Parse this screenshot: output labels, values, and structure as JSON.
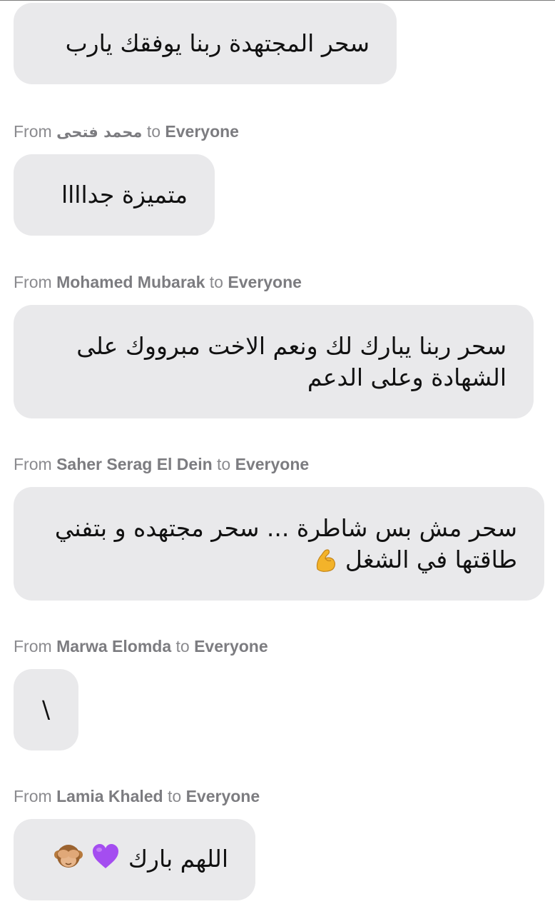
{
  "messages": [
    {
      "text": "سحر المجتهدة ربنا يوفقك يارب"
    },
    {
      "from_label": "From",
      "sender": "محمد فتحى",
      "to_label": "to",
      "recipient": "Everyone",
      "text": "متميزة جداااا"
    },
    {
      "from_label": "From",
      "sender": "Mohamed Mubarak",
      "to_label": "to",
      "recipient": "Everyone",
      "text": "سحر ربنا يبارك لك ونعم الاخت مبرووك على الشهادة وعلى الدعم"
    },
    {
      "from_label": "From",
      "sender": "Saher Serag El Dein",
      "to_label": "to",
      "recipient": "Everyone",
      "text": "سحر مش بس شاطرة ... سحر مجتهده و بتفني طاقتها في الشغل",
      "emoji": "flexed-biceps"
    },
    {
      "from_label": "From",
      "sender": "Marwa Elomda",
      "to_label": "to",
      "recipient": "Everyone",
      "text": "\\"
    },
    {
      "from_label": "From",
      "sender": "Lamia Khaled",
      "to_label": "to",
      "recipient": "Everyone",
      "text": "اللهم بارك",
      "emoji": [
        "purple-heart",
        "see-no-evil-monkey"
      ]
    }
  ],
  "colors": {
    "bubble_bg": "#e9e9eb",
    "sender_text": "#8a8a8e",
    "message_text": "#111111",
    "heart": "#a44df0",
    "muscle": "#f3b32a",
    "monkey": "#b77a3d"
  }
}
